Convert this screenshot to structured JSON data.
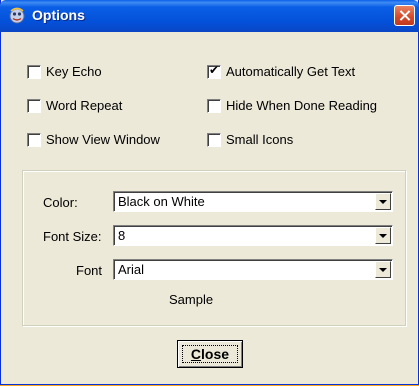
{
  "window": {
    "title": "Options",
    "title_icon": "options-icon",
    "close_icon": "close-icon"
  },
  "checkboxes": [
    {
      "label": "Key Echo",
      "checked": false
    },
    {
      "label": "Automatically Get Text",
      "checked": true
    },
    {
      "label": "Word Repeat",
      "checked": false
    },
    {
      "label": "Hide When Done Reading",
      "checked": false
    },
    {
      "label": "Show View Window",
      "checked": false
    },
    {
      "label": "Small Icons",
      "checked": false
    }
  ],
  "settings": {
    "color": {
      "label": "Color:",
      "value": "Black on White"
    },
    "font_size": {
      "label": "Font Size:",
      "value": "8"
    },
    "font": {
      "label": "Font",
      "value": "Arial"
    },
    "sample": "Sample"
  },
  "buttons": {
    "close_first": "C",
    "close_rest": "lose"
  },
  "colors": {
    "titlebar": "#0a5fe6",
    "window_bg": "#ece9d8",
    "desktop": "#f6a81e"
  }
}
